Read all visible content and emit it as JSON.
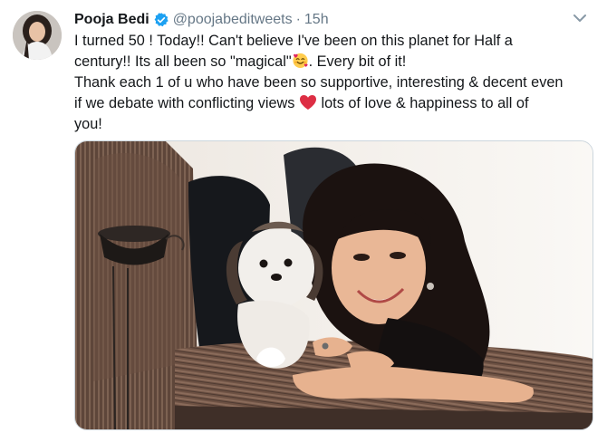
{
  "tweet": {
    "author": {
      "display_name": "Pooja Bedi",
      "handle": "@poojabeditweets",
      "verified": true,
      "avatar_icon": "profile-avatar"
    },
    "separator": "·",
    "time": "15h",
    "text_lines": [
      "I turned 50 ! Today!! Can't believe I've been on this planet for Half a",
      "century!! Its all been so \"magical\"",
      ". Every bit of it!",
      "Thank each 1 of u who have been so supportive, interesting & decent even",
      "if we debate with conflicting views",
      " lots of love & happiness to all of",
      "you!"
    ],
    "emojis": [
      "smiling-face-with-hearts-emoji",
      "red-heart-emoji"
    ],
    "menu_icon": "chevron-down-icon",
    "colors": {
      "text": "#14171a",
      "secondary": "#657786",
      "verified": "#1da1f2",
      "heart": "#e0245e",
      "border": "#ccd6dd"
    }
  }
}
